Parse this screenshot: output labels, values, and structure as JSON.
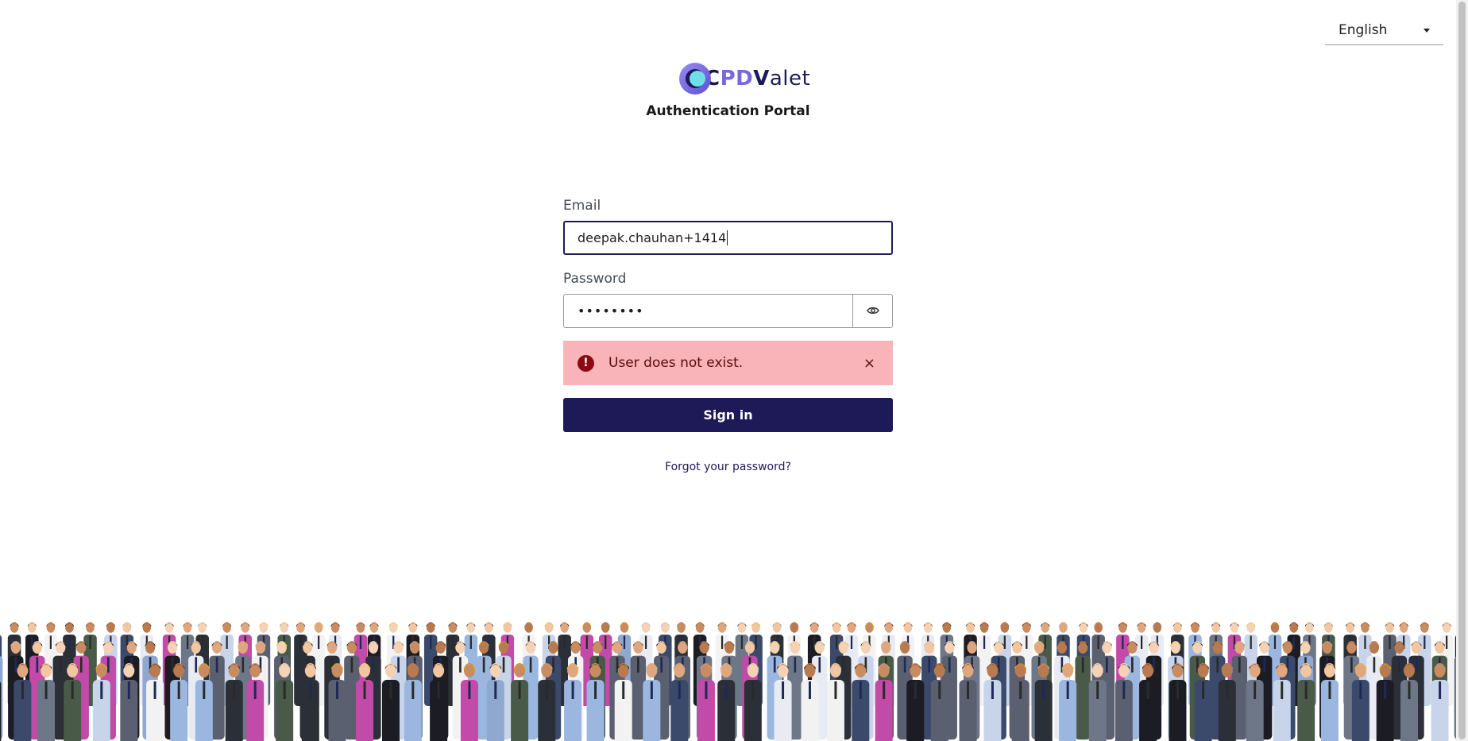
{
  "language": {
    "selected": "English"
  },
  "brand": {
    "logo_c": "C",
    "logo_pd": "PD",
    "logo_v": "V",
    "logo_alet": "alet",
    "subtitle": "Authentication Portal"
  },
  "form": {
    "email_label": "Email",
    "email_value": "deepak.chauhan+1414",
    "password_label": "Password",
    "password_value": "••••••••",
    "error_message": "User does not exist.",
    "error_icon": "!",
    "close_glyph": "×",
    "signin_label": "Sign in",
    "forgot_label": "Forgot your password?"
  },
  "colors": {
    "primary": "#1e1a57",
    "error_bg": "#f8b4b9",
    "error_text": "#5b0a10"
  },
  "icons": {
    "language_caret": "caret-down-icon",
    "password_toggle": "eye-icon",
    "error": "exclamation-circle-icon",
    "dismiss": "close-icon"
  }
}
